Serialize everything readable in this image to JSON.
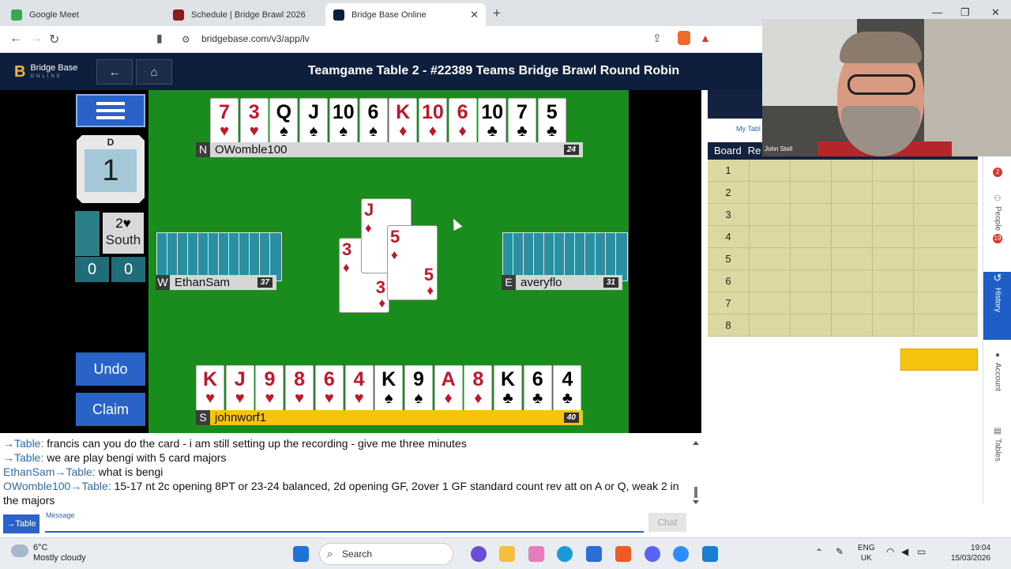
{
  "browser": {
    "tabs": [
      {
        "label": "Google Meet",
        "color": "#34a853"
      },
      {
        "label": "Schedule | Bridge Brawl 2026",
        "color": "#8b1a1a"
      },
      {
        "label": "Bridge Base Online",
        "color": "#0d1f3c"
      }
    ],
    "url": "bridgebase.com/v3/app/lv"
  },
  "app": {
    "logo_line1": "Bridge Base",
    "logo_line2": "ONLINE",
    "title": "Teamgame Table 2 - #22389 Teams Bridge Brawl Round Robin"
  },
  "left": {
    "dealer_label": "D",
    "board_number": "1",
    "contract": "2♥",
    "declarer": "South",
    "tricks_ns": "0",
    "tricks_ew": "0",
    "undo_label": "Undo",
    "claim_label": "Claim"
  },
  "north": {
    "dir": "N",
    "name": "OWomble100",
    "hcp": "24",
    "cards": [
      {
        "r": "7",
        "s": "♥",
        "c": "red"
      },
      {
        "r": "3",
        "s": "♥",
        "c": "red"
      },
      {
        "r": "Q",
        "s": "♠",
        "c": "black"
      },
      {
        "r": "J",
        "s": "♠",
        "c": "black"
      },
      {
        "r": "10",
        "s": "♠",
        "c": "black"
      },
      {
        "r": "6",
        "s": "♠",
        "c": "black"
      },
      {
        "r": "K",
        "s": "♦",
        "c": "red"
      },
      {
        "r": "10",
        "s": "♦",
        "c": "red"
      },
      {
        "r": "6",
        "s": "♦",
        "c": "red"
      },
      {
        "r": "10",
        "s": "♣",
        "c": "black"
      },
      {
        "r": "7",
        "s": "♣",
        "c": "black"
      },
      {
        "r": "5",
        "s": "♣",
        "c": "black"
      }
    ]
  },
  "south": {
    "dir": "S",
    "name": "johnworf1",
    "hcp": "40",
    "cards": [
      {
        "r": "K",
        "s": "♥",
        "c": "red"
      },
      {
        "r": "J",
        "s": "♥",
        "c": "red"
      },
      {
        "r": "9",
        "s": "♥",
        "c": "red"
      },
      {
        "r": "8",
        "s": "♥",
        "c": "red"
      },
      {
        "r": "6",
        "s": "♥",
        "c": "red"
      },
      {
        "r": "4",
        "s": "♥",
        "c": "red"
      },
      {
        "r": "K",
        "s": "♠",
        "c": "black"
      },
      {
        "r": "9",
        "s": "♠",
        "c": "black"
      },
      {
        "r": "A",
        "s": "♦",
        "c": "red"
      },
      {
        "r": "8",
        "s": "♦",
        "c": "red"
      },
      {
        "r": "K",
        "s": "♣",
        "c": "black"
      },
      {
        "r": "6",
        "s": "♣",
        "c": "black"
      },
      {
        "r": "4",
        "s": "♣",
        "c": "black"
      }
    ]
  },
  "west": {
    "dir": "W",
    "name": "EthanSam",
    "hcp": "37",
    "card_count": 12
  },
  "east": {
    "dir": "E",
    "name": "averyflo",
    "hcp": "31",
    "card_count": 12
  },
  "trick": {
    "north_card": {
      "r": "J",
      "s": "♦"
    },
    "east_card": {
      "r": "5",
      "s": "♦"
    },
    "west_card": {
      "r": "3",
      "s": "♦"
    }
  },
  "scores": {
    "my_table_tab": "My Tabl",
    "col_board": "Board",
    "col_result": "Re",
    "boards": [
      "1",
      "2",
      "3",
      "4",
      "5",
      "6",
      "7",
      "8"
    ]
  },
  "side_tabs": {
    "people": "People",
    "people_badge": "19",
    "history": "History",
    "account": "Account",
    "tables": "Tables",
    "top_badge": "2"
  },
  "video": {
    "participant": "John Stell"
  },
  "chat": {
    "lines": [
      {
        "from": "→Table:",
        "text": " francis can you do the card - i am still setting up the recording - give me three minutes"
      },
      {
        "from": "→Table:",
        "text": " we are play bengi with 5 card majors"
      },
      {
        "from": "EthanSam→Table:",
        "text": " what is bengi"
      },
      {
        "from": "OWomble100→Table:",
        "text": " 15-17 nt 2c opening 8PT or 23-24 balanced, 2d opening GF, 2over 1 GF standard count rev att on A or Q, weak 2 in the majors"
      }
    ],
    "to_label": "→Table",
    "message_label": "Message",
    "chat_button": "Chat"
  },
  "taskbar": {
    "temp": "6°C",
    "weather": "Mostly cloudy",
    "search": "Search",
    "lang1": "ENG",
    "lang2": "UK",
    "time": "19:04",
    "date": "15/03/2026"
  }
}
